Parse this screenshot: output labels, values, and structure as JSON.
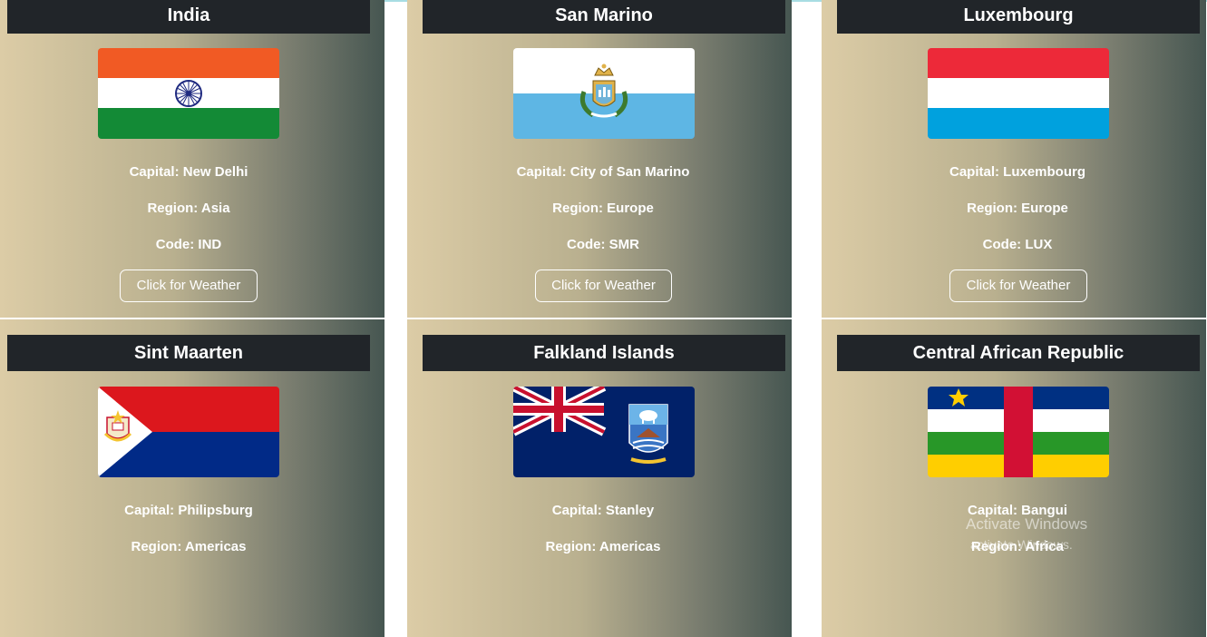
{
  "cards": [
    {
      "name": "India",
      "capital": "Capital: New Delhi",
      "region": "Region: Asia",
      "code": "Code: IND",
      "button": "Click for Weather"
    },
    {
      "name": "San Marino",
      "capital": "Capital: City of San Marino",
      "region": "Region: Europe",
      "code": "Code: SMR",
      "button": "Click for Weather"
    },
    {
      "name": "Luxembourg",
      "capital": "Capital: Luxembourg",
      "region": "Region: Europe",
      "code": "Code: LUX",
      "button": "Click for Weather"
    },
    {
      "name": "Sint Maarten",
      "capital": "Capital: Philipsburg",
      "region": "Region: Americas"
    },
    {
      "name": "Falkland Islands",
      "capital": "Capital: Stanley",
      "region": "Region: Americas"
    },
    {
      "name": "Central African Republic",
      "capital": "Capital: Bangui",
      "region": "Region: Africa"
    }
  ],
  "watermark": {
    "title": "Activate Windows",
    "subtitle": "activate Windows."
  },
  "colors": {
    "header_bg": "#212529",
    "card_gradient_start": "#dccca6",
    "card_gradient_end": "#465651"
  }
}
